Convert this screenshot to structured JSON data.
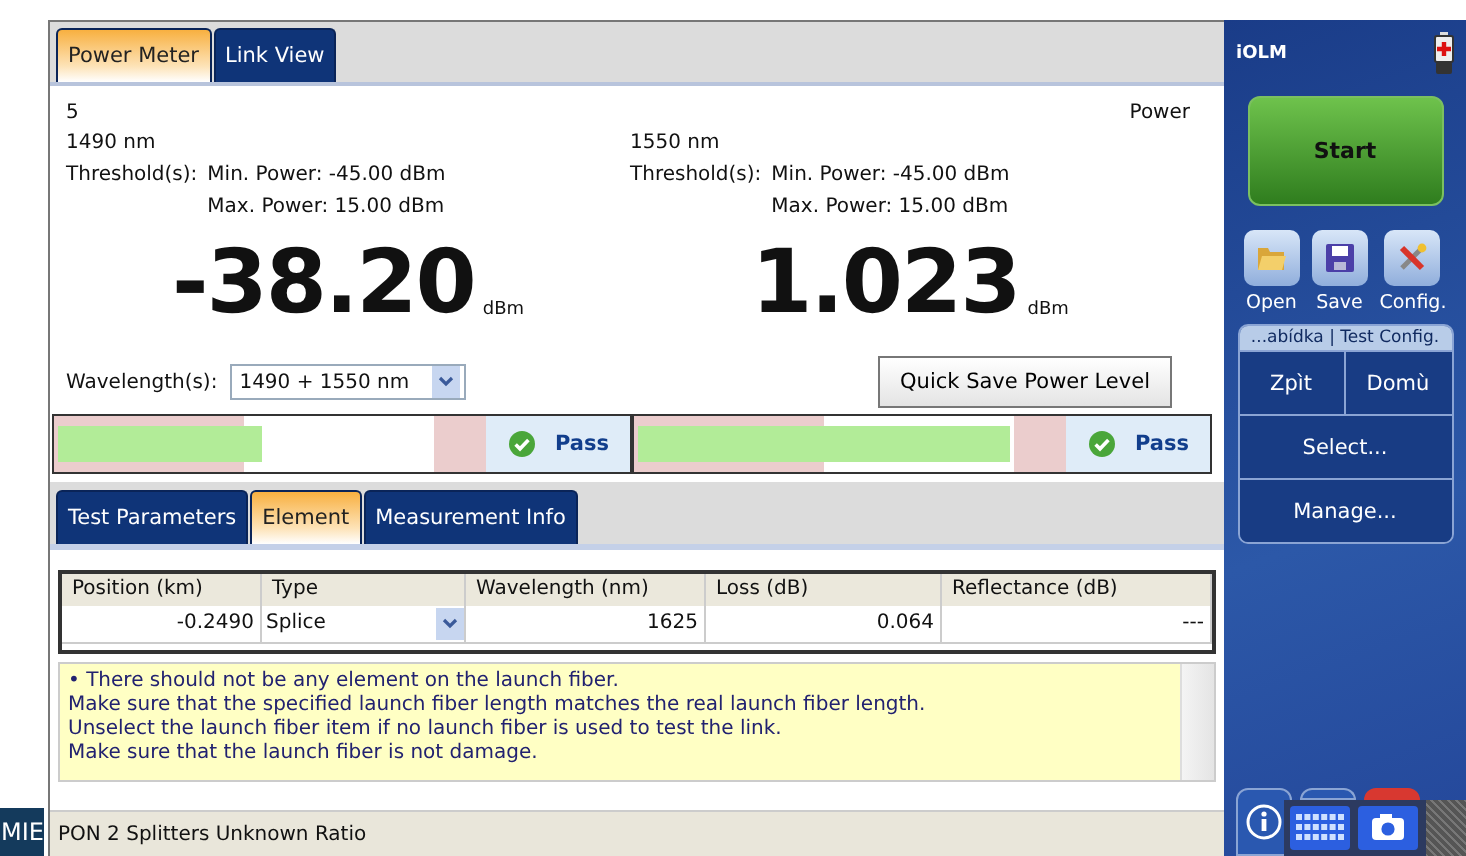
{
  "tabs": [
    {
      "label": "Power Meter",
      "selected": true
    },
    {
      "label": "Link View",
      "selected": false
    }
  ],
  "meter_header": {
    "index": "5",
    "mode": "Power"
  },
  "channels": [
    {
      "wavelength": "1490 nm",
      "threshold_label": "Threshold(s):",
      "min": "Min. Power: -45.00 dBm",
      "max": "Max. Power: 15.00 dBm",
      "reading": "-38.20",
      "unit": "dBm",
      "level": 0.47,
      "result": "Pass"
    },
    {
      "wavelength": "1550 nm",
      "threshold_label": "Threshold(s):",
      "min": "Min. Power: -45.00 dBm",
      "max": "Max. Power: 15.00 dBm",
      "reading": "1.023",
      "unit": "dBm",
      "level": 0.86,
      "result": "Pass"
    }
  ],
  "wavelength_select": {
    "label": "Wavelength(s):",
    "value": "1490 + 1550 nm"
  },
  "quick_save_button": "Quick Save Power Level",
  "lower_tabs": [
    {
      "label": "Test Parameters",
      "selected": false
    },
    {
      "label": "Element",
      "selected": true
    },
    {
      "label": "Measurement Info",
      "selected": false
    }
  ],
  "table": {
    "columns": [
      "Position (km)",
      "Type",
      "Wavelength (nm)",
      "Loss (dB)",
      "Reflectance (dB)"
    ],
    "rows": [
      {
        "cells": [
          "-0.2490",
          "Splice",
          "1625",
          "0.064",
          "---"
        ]
      }
    ]
  },
  "notes": [
    "• There should not be any element on the launch fiber.",
    "Make sure that the specified launch fiber length matches the real launch fiber length.",
    "Unselect the launch fiber item if  no launch fiber is used to test the link.",
    "Make sure that the launch fiber is not damage."
  ],
  "status_bar": "PON 2 Splitters Unknown Ratio",
  "side_label": "MIE",
  "sidebar": {
    "title": "iOLM",
    "start_button": "Start",
    "tools": [
      {
        "label": "Open",
        "kind": "open"
      },
      {
        "label": "Save",
        "kind": "save"
      },
      {
        "label": "Config.",
        "kind": "config"
      }
    ],
    "menu_header": "...abídka | Test Config.",
    "menu_items": [
      "Zpìt",
      "Domù",
      "Select...",
      "Manage..."
    ]
  }
}
